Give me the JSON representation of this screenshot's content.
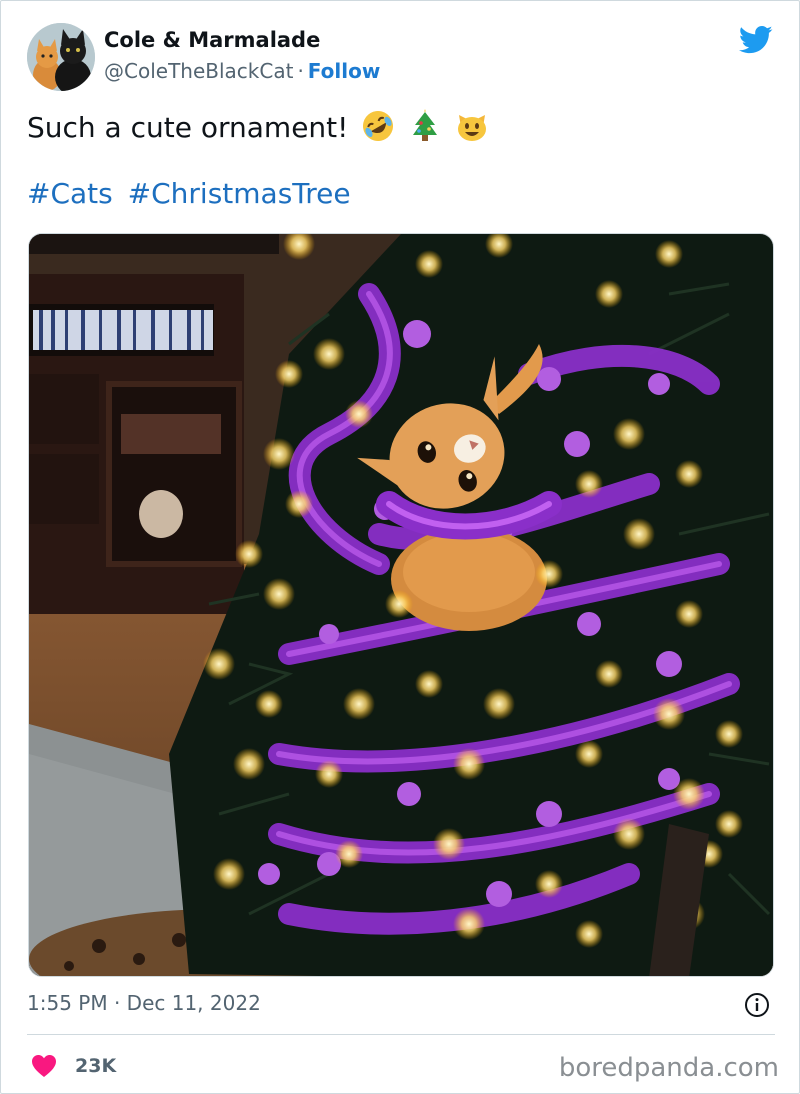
{
  "author": {
    "display_name": "Cole & Marmalade",
    "handle": "@ColeTheBlackCat",
    "separator": "·",
    "follow_label": "Follow"
  },
  "tweet": {
    "text": "Such a cute ornament!",
    "emojis": [
      "rolling-on-floor-laughing-emoji",
      "christmas-tree-emoji",
      "smiling-cat-emoji"
    ],
    "hashtags": [
      "#Cats",
      "#ChristmasTree"
    ]
  },
  "media": {
    "icon": "photo-cat-in-christmas-tree"
  },
  "meta": {
    "time": "1:55 PM",
    "separator": "·",
    "date": "Dec 11, 2022"
  },
  "engagement": {
    "likes": "23K"
  },
  "watermark": "boredpanda.com",
  "colors": {
    "link": "#1d6fbf",
    "twitter_blue": "#1d9bf0",
    "heart": "#f91880",
    "muted": "#536471"
  }
}
